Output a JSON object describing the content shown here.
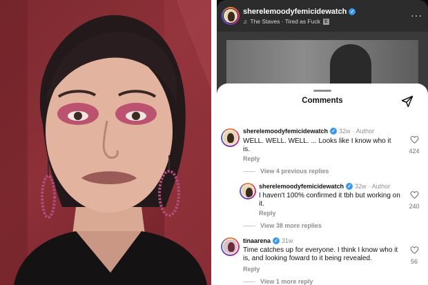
{
  "reel": {
    "username": "sherelemoodyfemicidewatch",
    "audio": "The Staves · Tired as Fuck",
    "explicit_badge": "E",
    "more": "···"
  },
  "comments_sheet": {
    "title": "Comments"
  },
  "comments": [
    {
      "username": "sherelemoodyfemicidewatch",
      "time": "32w",
      "author_label": "· Author",
      "text": "WELL. WELL. WELL. ... Looks like I know who it is.",
      "reply_label": "Reply",
      "likes": "424",
      "view_replies": "View 4 previous replies"
    },
    {
      "username": "sherelemoodyfemicidewatch",
      "time": "32w",
      "author_label": "· Author",
      "text": "I haven't 100% confirmed it tbh but working on it.",
      "reply_label": "Reply",
      "likes": "240",
      "view_replies": "View 38 more replies"
    },
    {
      "username": "tinaarena",
      "time": "31w",
      "author_label": "",
      "text": "Time catches up for everyone. I think I know who it is, and looking foward to it being revealed.",
      "reply_label": "Reply",
      "likes": "56",
      "view_replies": "View 1 more reply"
    }
  ],
  "colors": {
    "accent_verified": "#3897f0",
    "photo_background": "#8e3038"
  }
}
